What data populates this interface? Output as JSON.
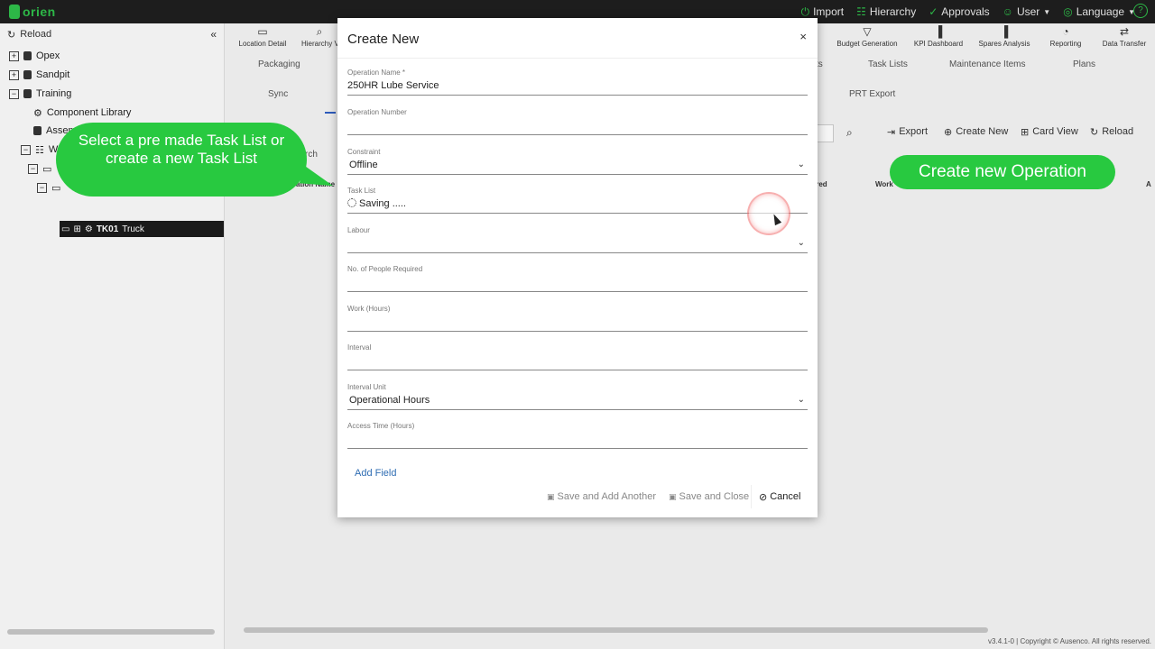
{
  "topbar": {
    "logo": "orien",
    "nav": [
      {
        "label": "Import",
        "icon": "import-icon"
      },
      {
        "label": "Hierarchy",
        "icon": "hierarchy-icon"
      },
      {
        "label": "Approvals",
        "icon": "check-icon"
      },
      {
        "label": "User",
        "icon": "user-icon"
      },
      {
        "label": "Language",
        "icon": "globe-icon"
      }
    ],
    "help": "?"
  },
  "sidebar": {
    "reload": "Reload",
    "tree": [
      "Opex",
      "Sandpit",
      "Training",
      "Component Library",
      "Assem",
      "W"
    ],
    "selected_code": "TK01",
    "selected_name": "Truck"
  },
  "toolbar": {
    "left": [
      "Location Detail",
      "Hierarchy V"
    ],
    "right": [
      "Budget Generation",
      "KPI Dashboard",
      "Spares Analysis",
      "Reporting",
      "Data Transfer"
    ]
  },
  "tabs_row1": [
    "Packaging",
    "ts",
    "Task Lists",
    "Maintenance Items",
    "Plans"
  ],
  "tabs_row2": [
    "Sync",
    "PRT Export"
  ],
  "actions": {
    "export": "Export",
    "create_new": "Create New",
    "card_view": "Card View",
    "reload": "Reload"
  },
  "grid": {
    "search_partial": "rch",
    "col_operation_name": "ation Name",
    "col_ired": "ired",
    "col_work": "Work",
    "col_a": "A"
  },
  "modal": {
    "title": "Create New",
    "close": "×",
    "fields": {
      "operation_name": {
        "label": "Operation Name *",
        "value": "250HR Lube Service"
      },
      "operation_number": {
        "label": "Operation Number",
        "value": ""
      },
      "constraint": {
        "label": "Constraint",
        "value": "Offline"
      },
      "task_list": {
        "label": "Task List",
        "value": "Saving ....."
      },
      "labour": {
        "label": "Labour",
        "value": ""
      },
      "people": {
        "label": "No. of People Required",
        "value": ""
      },
      "work": {
        "label": "Work (Hours)",
        "value": ""
      },
      "interval": {
        "label": "Interval",
        "value": ""
      },
      "interval_unit": {
        "label": "Interval Unit",
        "value": "Operational Hours"
      },
      "access_time": {
        "label": "Access Time (Hours)",
        "value": ""
      }
    },
    "add_field": "Add Field",
    "buttons": {
      "save_add": "Save and Add Another",
      "save_close": "Save and Close",
      "cancel": "Cancel"
    }
  },
  "callouts": {
    "left": "Select a pre made Task List or create a new Task List",
    "right": "Create new Operation"
  },
  "footer": {
    "copyright": "v3.4.1-0 | Copyright © Ausenco. All rights reserved."
  }
}
